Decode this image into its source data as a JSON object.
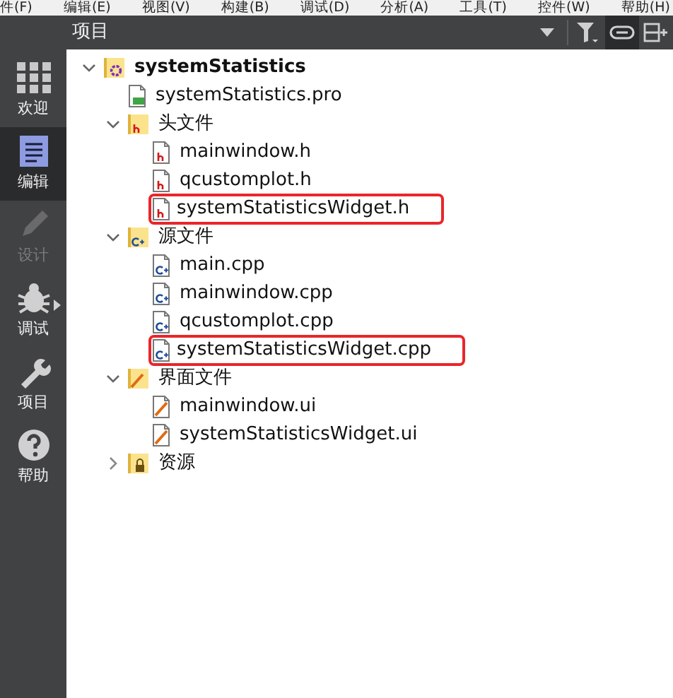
{
  "menu_bar": [
    "件(F)",
    "编辑(E)",
    "视图(V)",
    "构建(B)",
    "调试(D)",
    "分析(A)",
    "工具(T)",
    "控件(W)",
    "帮助(H)"
  ],
  "mode_bar": [
    {
      "label": "欢迎",
      "kind": "welcome",
      "selected": false,
      "disabled": false
    },
    {
      "label": "编辑",
      "kind": "edit",
      "selected": true,
      "disabled": false
    },
    {
      "label": "设计",
      "kind": "design",
      "selected": false,
      "disabled": true
    },
    {
      "label": "调试",
      "kind": "debug",
      "selected": false,
      "disabled": false
    },
    {
      "label": "项目",
      "kind": "projects",
      "selected": false,
      "disabled": false
    },
    {
      "label": "帮助",
      "kind": "help",
      "selected": false,
      "disabled": false
    }
  ],
  "panel": {
    "title": "项目",
    "tools": [
      {
        "kind": "dropdown",
        "on": false
      },
      {
        "kind": "filter",
        "on": false
      },
      {
        "kind": "link",
        "on": true
      },
      {
        "kind": "split",
        "on": false
      }
    ]
  },
  "tree": [
    {
      "label": "systemStatistics",
      "kind": "project",
      "expanded": true,
      "children": [
        {
          "label": "systemStatistics.pro",
          "kind": "pro"
        },
        {
          "label": "头文件",
          "kind": "folder-h",
          "expanded": true,
          "children": [
            {
              "label": "mainwindow.h",
              "kind": "file-h"
            },
            {
              "label": "qcustomplot.h",
              "kind": "file-h"
            },
            {
              "label": "systemStatisticsWidget.h",
              "kind": "file-h",
              "annotated": true
            }
          ]
        },
        {
          "label": "源文件",
          "kind": "folder-cpp",
          "expanded": true,
          "children": [
            {
              "label": "main.cpp",
              "kind": "file-cpp"
            },
            {
              "label": "mainwindow.cpp",
              "kind": "file-cpp"
            },
            {
              "label": "qcustomplot.cpp",
              "kind": "file-cpp"
            },
            {
              "label": "systemStatisticsWidget.cpp",
              "kind": "file-cpp",
              "annotated": true
            }
          ]
        },
        {
          "label": "界面文件",
          "kind": "folder-ui",
          "expanded": true,
          "children": [
            {
              "label": "mainwindow.ui",
              "kind": "file-ui"
            },
            {
              "label": "systemStatisticsWidget.ui",
              "kind": "file-ui"
            }
          ]
        },
        {
          "label": "资源",
          "kind": "folder-res",
          "expanded": false
        }
      ]
    }
  ]
}
